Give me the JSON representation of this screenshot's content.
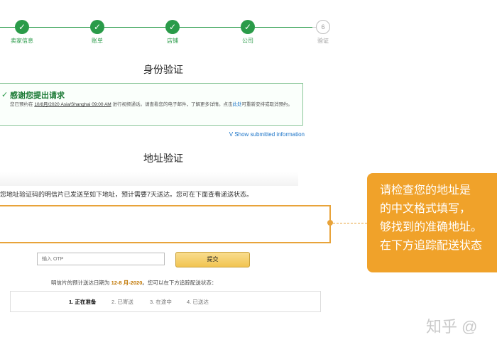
{
  "stepper": {
    "steps": [
      {
        "label": "卖家信息",
        "state": "done"
      },
      {
        "label": "账单",
        "state": "done"
      },
      {
        "label": "店铺",
        "state": "done"
      },
      {
        "label": "公司",
        "state": "done"
      },
      {
        "label": "验证",
        "state": "pending",
        "number": "6"
      }
    ]
  },
  "identity": {
    "heading": "身份验证",
    "success_title": "感谢您提出请求",
    "success_text_1": "您已预约在",
    "success_datetime": "10/8月/2020 Asia/Shanghai 09:00 AM",
    "success_text_2": "进行视频通话。请查看您的电子邮件，了解更多详情。点击",
    "success_link": "此处",
    "success_text_3": "可重新安排或取消预约。",
    "show_info_link": "V Show submitted information"
  },
  "address": {
    "heading": "地址验证",
    "intro": "您地址验证码的明信片已发送至如下地址，预计需要7天送达。您可在下面查看递送状态。",
    "otp_placeholder": "输入 OTP",
    "submit_label": "提交",
    "delivery_prefix": "明信片的预计送达日期为",
    "delivery_date": "12-8 月-2020",
    "delivery_suffix": "。您可以在下方追踪配送状态：",
    "statuses": [
      "1. 正在准备",
      "2. 已寄送",
      "3. 在途中",
      "4. 已送达"
    ]
  },
  "callout": {
    "lines": [
      "请检查您的地址是",
      "的中文格式填写，",
      "够找到的准确地址。",
      "在下方追踪配送状态"
    ]
  },
  "watermark": "知乎 @",
  "colors": {
    "success_green": "#2a9b49",
    "accent_orange": "#f0a22a",
    "link_blue": "#1a73c7"
  }
}
